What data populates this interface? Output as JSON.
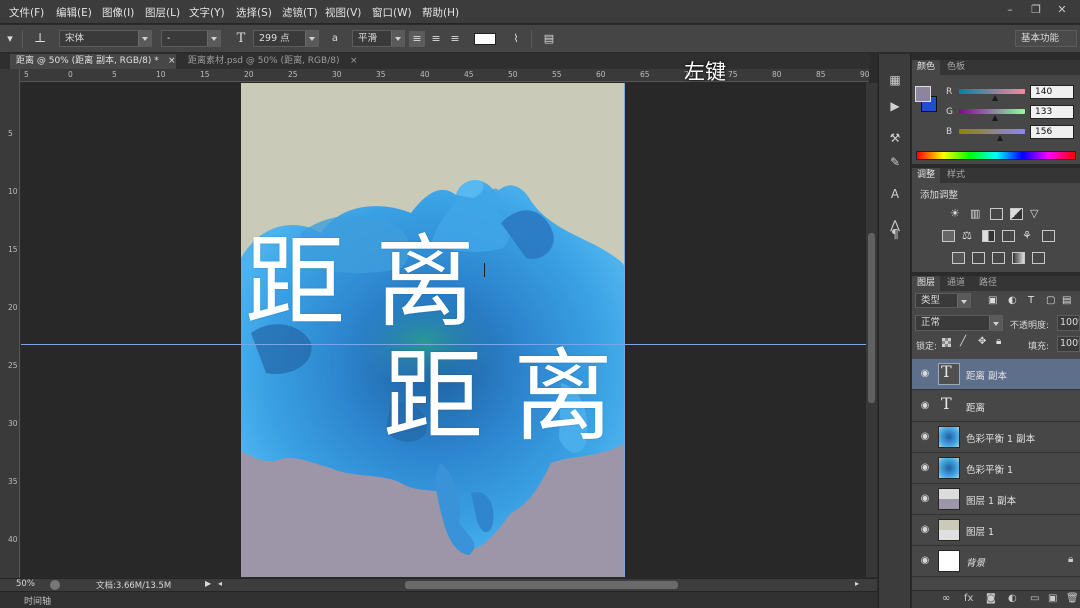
{
  "menubar": {
    "items": [
      "文件(F)",
      "编辑(E)",
      "图像(I)",
      "图层(L)",
      "文字(Y)",
      "选择(S)",
      "滤镜(T)",
      "视图(V)",
      "窗口(W)",
      "帮助(H)"
    ],
    "window_buttons": [
      "minimize-icon",
      "restore-icon",
      "close-icon"
    ]
  },
  "options": {
    "font_family": "宋体",
    "font_style": "-",
    "font_size": "299 点",
    "aa_label": "a",
    "antialias": "平滑",
    "workspace": "基本功能"
  },
  "tabs": [
    {
      "label": "距离 @ 50% (距离 副本, RGB/8) *",
      "close": "×"
    },
    {
      "label": "距离素材.psd @ 50% (距离, RGB/8)",
      "close": "×"
    }
  ],
  "overlay_caption": "左键",
  "rulers": {
    "top": [
      "5",
      "0",
      "5",
      "10",
      "15",
      "20",
      "25",
      "30",
      "35",
      "40",
      "45",
      "50",
      "55",
      "60",
      "65",
      "70",
      "75",
      "80",
      "85",
      "90"
    ],
    "left": [
      "5",
      "10",
      "15",
      "20",
      "25",
      "30",
      "35",
      "40"
    ]
  },
  "canvas": {
    "text_top": "距离",
    "text_bottom": "距离",
    "colors": {
      "upper_bg": "#c9cbb8",
      "lower_bg": "#9d95a8",
      "ink": "#3a8fdc",
      "guide": "#7aa6e6"
    }
  },
  "status": {
    "zoom": "50%",
    "doc_info": "文档:3.66M/13.5M",
    "timeline_label": "时间轴"
  },
  "color_panel": {
    "tabs": [
      "颜色",
      "色板"
    ],
    "channels": [
      {
        "label": "R",
        "value": "140"
      },
      {
        "label": "G",
        "value": "133"
      },
      {
        "label": "B",
        "value": "156"
      }
    ],
    "foreground": "#8c859c",
    "background": "#1f4fd0"
  },
  "adjust_panel": {
    "tabs": [
      "调整",
      "样式"
    ],
    "title": "添加调整"
  },
  "layers_panel": {
    "tabs": [
      "图层",
      "通道",
      "路径"
    ],
    "filter_kind": "类型",
    "blend_mode": "正常",
    "opacity_label": "不透明度:",
    "opacity_value": "100%",
    "lock_label": "锁定:",
    "fill_label": "填充:",
    "fill_value": "100%",
    "layers": [
      {
        "name": "距离 副本",
        "type": "text",
        "selected": true
      },
      {
        "name": "距离",
        "type": "text",
        "selected": false
      },
      {
        "name": "色彩平衡 1 副本",
        "type": "image",
        "thumb": "#2f7fc8",
        "selected": false
      },
      {
        "name": "色彩平衡 1",
        "type": "image",
        "thumb": "#2f7fc8",
        "selected": false
      },
      {
        "name": "图层 1 副本",
        "type": "image",
        "thumb": "#9d95a8",
        "selected": false
      },
      {
        "name": "图层 1",
        "type": "image",
        "thumb": "#c9cbb8",
        "selected": false
      },
      {
        "name": "背景",
        "type": "background",
        "thumb": "#ffffff",
        "selected": false
      }
    ]
  }
}
